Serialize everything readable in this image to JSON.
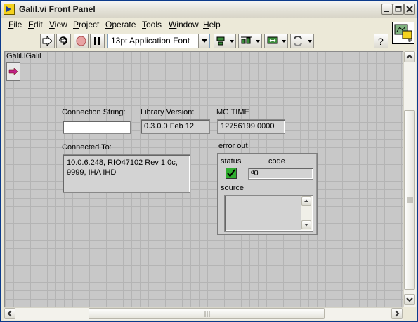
{
  "window": {
    "title": "Galil.vi Front Panel"
  },
  "menu": [
    "File",
    "Edit",
    "View",
    "Project",
    "Operate",
    "Tools",
    "Window",
    "Help"
  ],
  "menu_underline": [
    "F",
    "E",
    "V",
    "P",
    "O",
    "T",
    "W",
    "H"
  ],
  "menu_rest": [
    "ile",
    "dit",
    "iew",
    "roject",
    "perate",
    "ools",
    "indow",
    "elp"
  ],
  "toolbar": {
    "font_select": "13pt Application Font",
    "help": "?"
  },
  "panel": {
    "class_label": "Galil.lGalil",
    "connection_string": {
      "label": "Connection String:",
      "value": ""
    },
    "library_version": {
      "label": "Library Version:",
      "value": "0.3.0.0 Feb 12"
    },
    "mg_time": {
      "label": "MG TIME",
      "value": "12756199.0000"
    },
    "connected_to": {
      "label": "Connected To:",
      "value": "10.0.6.248, RIO47102 Rev 1.0c, 9999, IHA IHD"
    },
    "error_out": {
      "label": "error out",
      "status_label": "status",
      "code_label": "code",
      "code_value": "0",
      "code_prefix": "d",
      "source_label": "source",
      "source_value": "",
      "status_ok": true
    }
  },
  "colors": {
    "title_text": "#1b1b1b",
    "panel_bg": "#c8c8c8",
    "grid": "#b4b4b4",
    "status_ok": "#2fae2f"
  }
}
